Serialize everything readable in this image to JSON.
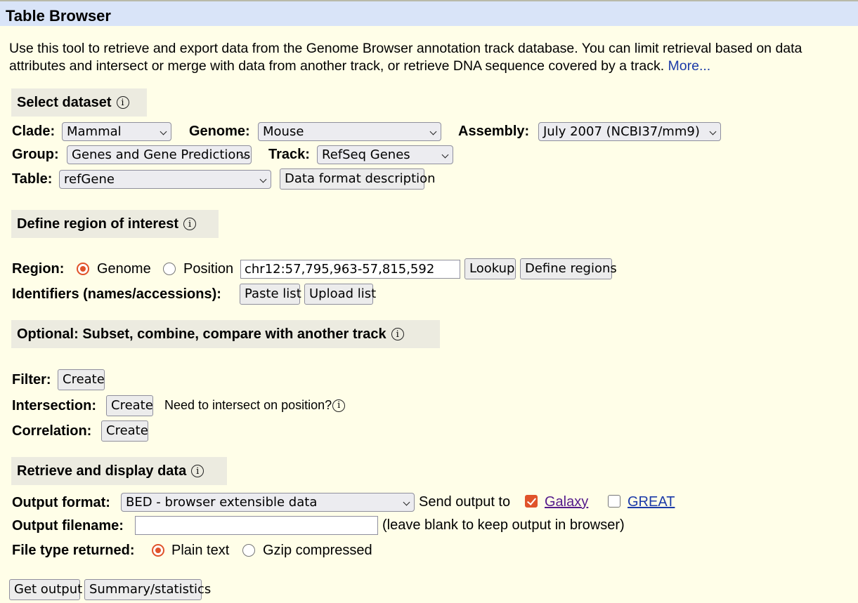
{
  "title": "Table Browser",
  "intro": {
    "text": "Use this tool to retrieve and export data from the Genome Browser annotation track database. You can limit retrieval based on data attributes and intersect or merge with data from another track, or retrieve DNA sequence covered by a track.",
    "more_link": "More..."
  },
  "info_icon": "i",
  "select_dataset": {
    "header": "Select dataset",
    "clade_label": "Clade:",
    "clade": "Mammal",
    "genome_label": "Genome:",
    "genome": "Mouse",
    "assembly_label": "Assembly:",
    "assembly": "July 2007 (NCBI37/mm9)",
    "group_label": "Group:",
    "group": "Genes and Gene Predictions",
    "track_label": "Track:",
    "track": "RefSeq Genes",
    "table_label": "Table:",
    "table": "refGene",
    "data_format_button": "Data format description"
  },
  "region": {
    "header": "Define region of interest",
    "region_label": "Region:",
    "genome_option": "Genome",
    "position_option": "Position",
    "selected": "Genome",
    "position_value": "chr12:57,795,963-57,815,592",
    "lookup_button": "Lookup",
    "define_regions_button": "Define regions",
    "identifiers_label": "Identifiers (names/accessions):",
    "paste_list_button": "Paste list",
    "upload_list_button": "Upload list"
  },
  "optional": {
    "header": "Optional: Subset, combine, compare with another track",
    "filter_label": "Filter:",
    "intersection_label": "Intersection:",
    "correlation_label": "Correlation:",
    "create_button": "Create",
    "intersect_note": "Need to intersect on position?"
  },
  "retrieve": {
    "header": "Retrieve and display data",
    "output_format_label": "Output format:",
    "output_format": "BED - browser extensible data",
    "send_output_label": "Send output to",
    "galaxy_label": "Galaxy",
    "galaxy_checked": true,
    "great_label": "GREAT",
    "great_checked": false,
    "output_filename_label": "Output filename:",
    "output_filename_value": "",
    "filename_note": "(leave blank to keep output in browser)",
    "file_type_label": "File type returned:",
    "plain_text_option": "Plain text",
    "gzip_option": "Gzip compressed",
    "file_type_selected": "Plain text",
    "get_output_button": "Get output",
    "summary_button": "Summary/statistics"
  },
  "colors": {
    "page_background": "#fffee8",
    "title_background": "#d9e4f8",
    "section_header_background": "#ecebe0",
    "link_blue": "#1b3aa8",
    "visited_link": "#551a8b",
    "checked_accent": "#e0532a"
  }
}
